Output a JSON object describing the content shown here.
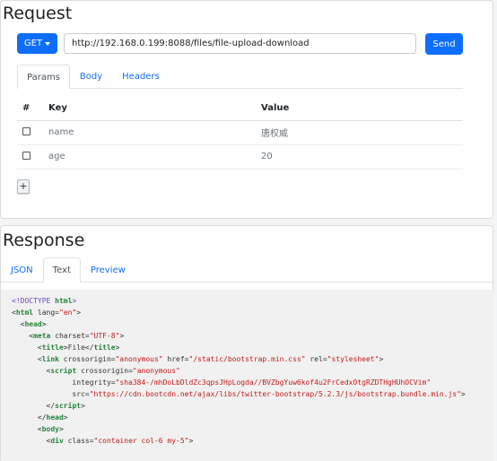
{
  "request": {
    "title": "Request",
    "method": "GET",
    "url": "http://192.168.0.199:8088/files/file-upload-download",
    "send_label": "Send",
    "tabs": [
      {
        "label": "Params",
        "active": true
      },
      {
        "label": "Body",
        "active": false
      },
      {
        "label": "Headers",
        "active": false
      }
    ],
    "params": {
      "headers": {
        "index": "#",
        "key": "Key",
        "value": "Value"
      },
      "rows": [
        {
          "key": "name",
          "value": "唐权威"
        },
        {
          "key": "age",
          "value": "20"
        }
      ],
      "add_label": "+"
    }
  },
  "response": {
    "title": "Response",
    "tabs": [
      {
        "label": "JSON",
        "active": false
      },
      {
        "label": "Text",
        "active": true
      },
      {
        "label": "Preview",
        "active": false
      }
    ],
    "code_lines": [
      [
        {
          "t": "doctype",
          "s": "<!DOCTYPE "
        },
        {
          "t": "tag",
          "s": "html"
        },
        {
          "t": "doctype",
          "s": ">"
        }
      ],
      [
        {
          "t": "punct",
          "s": "<"
        },
        {
          "t": "tag",
          "s": "html"
        },
        {
          "t": "attr",
          "s": " lang="
        },
        {
          "t": "str",
          "s": "\"en\""
        },
        {
          "t": "punct",
          "s": ">"
        }
      ],
      [
        {
          "t": "punct",
          "s": "  <"
        },
        {
          "t": "tag",
          "s": "head"
        },
        {
          "t": "punct",
          "s": ">"
        }
      ],
      [
        {
          "t": "punct",
          "s": "    <"
        },
        {
          "t": "tag",
          "s": "meta"
        },
        {
          "t": "attr",
          "s": " charset="
        },
        {
          "t": "str",
          "s": "\"UTF-8\""
        },
        {
          "t": "punct",
          "s": ">"
        }
      ],
      [
        {
          "t": "punct",
          "s": "      <"
        },
        {
          "t": "tag",
          "s": "title"
        },
        {
          "t": "punct",
          "s": ">File</"
        },
        {
          "t": "tag",
          "s": "title"
        },
        {
          "t": "punct",
          "s": ">"
        }
      ],
      [
        {
          "t": "punct",
          "s": "      <"
        },
        {
          "t": "tag",
          "s": "link"
        },
        {
          "t": "attr",
          "s": " crossorigin="
        },
        {
          "t": "str",
          "s": "\"anonymous\""
        },
        {
          "t": "attr",
          "s": " href="
        },
        {
          "t": "str",
          "s": "\"/static/bootstrap.min.css\""
        },
        {
          "t": "attr",
          "s": " rel="
        },
        {
          "t": "str",
          "s": "\"stylesheet\""
        },
        {
          "t": "punct",
          "s": ">"
        }
      ],
      [
        {
          "t": "punct",
          "s": "        <"
        },
        {
          "t": "tag",
          "s": "script"
        },
        {
          "t": "attr",
          "s": " crossorigin="
        },
        {
          "t": "str",
          "s": "\"anonymous\""
        }
      ],
      [
        {
          "t": "attr",
          "s": "              integrity="
        },
        {
          "t": "str",
          "s": "\"sha384-/mhDoLbDldZc3qpsJHpLogda//BVZbgYuw6kof4u2FrCedxOtgRZDTHgHUhOCVim\""
        }
      ],
      [
        {
          "t": "attr",
          "s": "              src="
        },
        {
          "t": "str",
          "s": "\"https://cdn.bootcdn.net/ajax/libs/twitter-bootstrap/5.2.3/js/bootstrap.bundle.min.js\""
        },
        {
          "t": "punct",
          "s": ">"
        }
      ],
      [
        {
          "t": "punct",
          "s": "        </"
        },
        {
          "t": "tag",
          "s": "script"
        },
        {
          "t": "punct",
          "s": ">"
        }
      ],
      [
        {
          "t": "punct",
          "s": "      </"
        },
        {
          "t": "tag",
          "s": "head"
        },
        {
          "t": "punct",
          "s": ">"
        }
      ],
      [
        {
          "t": "punct",
          "s": "      <"
        },
        {
          "t": "tag",
          "s": "body"
        },
        {
          "t": "punct",
          "s": ">"
        }
      ],
      [
        {
          "t": "punct",
          "s": "        <"
        },
        {
          "t": "tag",
          "s": "div"
        },
        {
          "t": "attr",
          "s": " class="
        },
        {
          "t": "str",
          "s": "\"container col-6 my-5\""
        },
        {
          "t": "punct",
          "s": ">"
        }
      ]
    ]
  }
}
